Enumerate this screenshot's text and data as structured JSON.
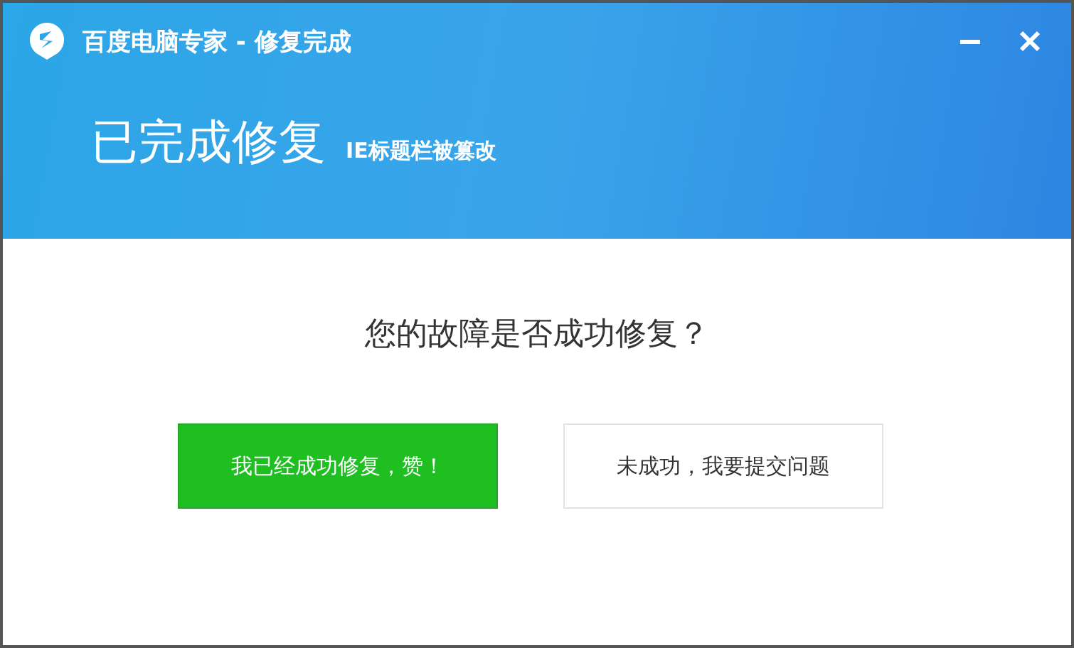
{
  "window": {
    "title": "百度电脑专家 - 修复完成"
  },
  "header": {
    "heading": "已完成修复",
    "subtitle": "IE标题栏被篡改"
  },
  "question": "您的故障是否成功修复？",
  "buttons": [
    {
      "label": "我已经成功修复，赞！",
      "kind": "primary"
    },
    {
      "label": "未成功，我要提交问题",
      "kind": "secondary"
    }
  ]
}
